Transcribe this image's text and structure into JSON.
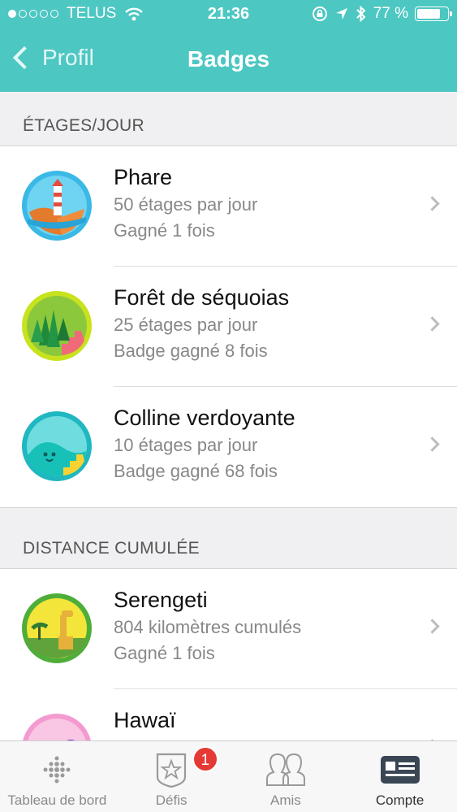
{
  "status": {
    "carrier": "TELUS",
    "time": "21:36",
    "battery": "77 %",
    "battery_level": 0.77
  },
  "nav": {
    "back_label": "Profil",
    "title": "Badges"
  },
  "sections": [
    {
      "header": "ÉTAGES/JOUR",
      "items": [
        {
          "title": "Phare",
          "line1": "50 étages par jour",
          "line2": "Gagné 1 fois",
          "icon": "lighthouse-badge-icon"
        },
        {
          "title": "Forêt de séquoias",
          "line1": "25 étages par jour",
          "line2": "Badge gagné 8 fois",
          "icon": "sequoia-forest-badge-icon"
        },
        {
          "title": "Colline verdoyante",
          "line1": "10 étages par jour",
          "line2": "Badge gagné 68 fois",
          "icon": "green-hill-badge-icon"
        }
      ]
    },
    {
      "header": "DISTANCE CUMULÉE",
      "items": [
        {
          "title": "Serengeti",
          "line1": "804 kilomètres cumulés",
          "line2": "Gagné 1 fois",
          "icon": "serengeti-badge-icon"
        },
        {
          "title": "Hawaï",
          "line1": "",
          "line2": "",
          "icon": "hawaii-badge-icon"
        }
      ]
    }
  ],
  "tabs": [
    {
      "label": "Tableau de bord",
      "icon": "dashboard-dots-icon"
    },
    {
      "label": "Défis",
      "icon": "challenge-star-icon",
      "badge": "1"
    },
    {
      "label": "Amis",
      "icon": "friends-icon"
    },
    {
      "label": "Compte",
      "icon": "account-card-icon",
      "active": true
    }
  ]
}
